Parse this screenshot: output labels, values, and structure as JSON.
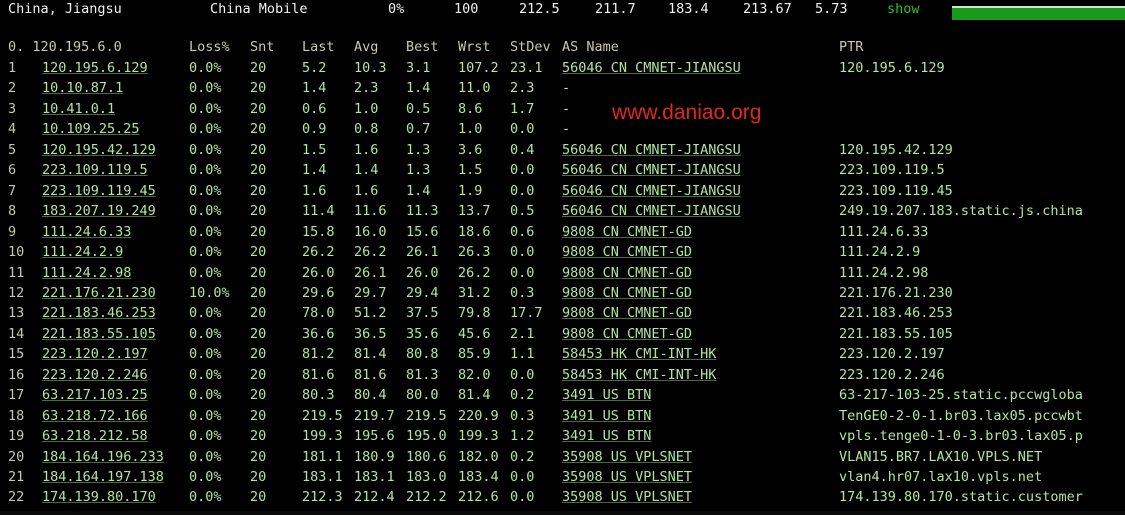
{
  "summary": {
    "location": "China, Jiangsu",
    "provider": "China Mobile",
    "loss": "0%",
    "sent": "100",
    "last": "212.5",
    "best": "211.7",
    "wrst": "183.4",
    "avg": "213.67",
    "stdev": "5.73",
    "show_label": "show"
  },
  "columns": {
    "index_ip": "0.  120.195.6.0",
    "loss": "Loss%",
    "snt": "Snt",
    "last": "Last",
    "avg": "Avg",
    "best": "Best",
    "wrst": "Wrst",
    "stdev": "StDev",
    "as_name": "AS Name",
    "ptr": "PTR"
  },
  "watermark": "www.daniao.org",
  "hops": [
    {
      "n": "1",
      "ip": "120.195.6.129",
      "loss": "0.0%",
      "snt": "20",
      "last": "5.2",
      "avg": "10.3",
      "best": "3.1",
      "wrst": "107.2",
      "stdev": "23.1",
      "as": "56046 CN CMNET-JIANGSU",
      "ptr": "120.195.6.129"
    },
    {
      "n": "2",
      "ip": "10.10.87.1",
      "loss": "0.0%",
      "snt": "20",
      "last": "1.4",
      "avg": "2.3",
      "best": "1.4",
      "wrst": "11.0",
      "stdev": "2.3",
      "as": "-",
      "ptr": ""
    },
    {
      "n": "3",
      "ip": "10.41.0.1",
      "loss": "0.0%",
      "snt": "20",
      "last": "0.6",
      "avg": "1.0",
      "best": "0.5",
      "wrst": "8.6",
      "stdev": "1.7",
      "as": "-",
      "ptr": ""
    },
    {
      "n": "4",
      "ip": "10.109.25.25",
      "loss": "0.0%",
      "snt": "20",
      "last": "0.9",
      "avg": "0.8",
      "best": "0.7",
      "wrst": "1.0",
      "stdev": "0.0",
      "as": "-",
      "ptr": ""
    },
    {
      "n": "5",
      "ip": "120.195.42.129",
      "loss": "0.0%",
      "snt": "20",
      "last": "1.5",
      "avg": "1.6",
      "best": "1.3",
      "wrst": "3.6",
      "stdev": "0.4",
      "as": "56046 CN CMNET-JIANGSU",
      "ptr": "120.195.42.129"
    },
    {
      "n": "6",
      "ip": "223.109.119.5",
      "loss": "0.0%",
      "snt": "20",
      "last": "1.4",
      "avg": "1.4",
      "best": "1.3",
      "wrst": "1.5",
      "stdev": "0.0",
      "as": "56046 CN CMNET-JIANGSU",
      "ptr": "223.109.119.5"
    },
    {
      "n": "7",
      "ip": "223.109.119.45",
      "loss": "0.0%",
      "snt": "20",
      "last": "1.6",
      "avg": "1.6",
      "best": "1.4",
      "wrst": "1.9",
      "stdev": "0.0",
      "as": "56046 CN CMNET-JIANGSU",
      "ptr": "223.109.119.45"
    },
    {
      "n": "8",
      "ip": "183.207.19.249",
      "loss": "0.0%",
      "snt": "20",
      "last": "11.4",
      "avg": "11.6",
      "best": "11.3",
      "wrst": "13.7",
      "stdev": "0.5",
      "as": "56046 CN CMNET-JIANGSU",
      "ptr": "249.19.207.183.static.js.china"
    },
    {
      "n": "9",
      "ip": "111.24.6.33",
      "loss": "0.0%",
      "snt": "20",
      "last": "15.8",
      "avg": "16.0",
      "best": "15.6",
      "wrst": "18.6",
      "stdev": "0.6",
      "as": "9808  CN CMNET-GD",
      "ptr": "111.24.6.33"
    },
    {
      "n": "10",
      "ip": "111.24.2.9",
      "loss": "0.0%",
      "snt": "20",
      "last": "26.2",
      "avg": "26.2",
      "best": "26.1",
      "wrst": "26.3",
      "stdev": "0.0",
      "as": "9808  CN CMNET-GD",
      "ptr": "111.24.2.9"
    },
    {
      "n": "11",
      "ip": "111.24.2.98",
      "loss": "0.0%",
      "snt": "20",
      "last": "26.0",
      "avg": "26.1",
      "best": "26.0",
      "wrst": "26.2",
      "stdev": "0.0",
      "as": "9808  CN CMNET-GD",
      "ptr": "111.24.2.98"
    },
    {
      "n": "12",
      "ip": "221.176.21.230",
      "loss": "10.0%",
      "snt": "20",
      "last": "29.6",
      "avg": "29.7",
      "best": "29.4",
      "wrst": "31.2",
      "stdev": "0.3",
      "as": "9808  CN CMNET-GD",
      "ptr": "221.176.21.230"
    },
    {
      "n": "13",
      "ip": "221.183.46.253",
      "loss": "0.0%",
      "snt": "20",
      "last": "78.0",
      "avg": "51.2",
      "best": "37.5",
      "wrst": "79.8",
      "stdev": "17.7",
      "as": "9808  CN CMNET-GD",
      "ptr": "221.183.46.253"
    },
    {
      "n": "14",
      "ip": "221.183.55.105",
      "loss": "0.0%",
      "snt": "20",
      "last": "36.6",
      "avg": "36.5",
      "best": "35.6",
      "wrst": "45.6",
      "stdev": "2.1",
      "as": "9808  CN CMNET-GD",
      "ptr": "221.183.55.105"
    },
    {
      "n": "15",
      "ip": "223.120.2.197",
      "loss": "0.0%",
      "snt": "20",
      "last": "81.2",
      "avg": "81.4",
      "best": "80.8",
      "wrst": "85.9",
      "stdev": "1.1",
      "as": "58453 HK CMI-INT-HK",
      "ptr": "223.120.2.197"
    },
    {
      "n": "16",
      "ip": "223.120.2.246",
      "loss": "0.0%",
      "snt": "20",
      "last": "81.6",
      "avg": "81.6",
      "best": "81.3",
      "wrst": "82.0",
      "stdev": "0.0",
      "as": "58453 HK CMI-INT-HK",
      "ptr": "223.120.2.246"
    },
    {
      "n": "17",
      "ip": "63.217.103.25",
      "loss": "0.0%",
      "snt": "20",
      "last": "80.3",
      "avg": "80.4",
      "best": "80.0",
      "wrst": "81.4",
      "stdev": "0.2",
      "as": "3491  US BTN",
      "ptr": "63-217-103-25.static.pccwgloba"
    },
    {
      "n": "18",
      "ip": "63.218.72.166",
      "loss": "0.0%",
      "snt": "20",
      "last": "219.5",
      "avg": "219.7",
      "best": "219.5",
      "wrst": "220.9",
      "stdev": "0.3",
      "as": "3491  US BTN",
      "ptr": "TenGE0-2-0-1.br03.lax05.pccwbt"
    },
    {
      "n": "19",
      "ip": "63.218.212.58",
      "loss": "0.0%",
      "snt": "20",
      "last": "199.3",
      "avg": "195.6",
      "best": "195.0",
      "wrst": "199.3",
      "stdev": "1.2",
      "as": "3491  US BTN",
      "ptr": "vpls.tenge0-1-0-3.br03.lax05.p"
    },
    {
      "n": "20",
      "ip": "184.164.196.233",
      "loss": "0.0%",
      "snt": "20",
      "last": "181.1",
      "avg": "180.9",
      "best": "180.6",
      "wrst": "182.0",
      "stdev": "0.2",
      "as": "35908 US VPLSNET",
      "ptr": "VLAN15.BR7.LAX10.VPLS.NET"
    },
    {
      "n": "21",
      "ip": "184.164.197.138",
      "loss": "0.0%",
      "snt": "20",
      "last": "183.1",
      "avg": "183.1",
      "best": "183.0",
      "wrst": "183.4",
      "stdev": "0.0",
      "as": "35908 US VPLSNET",
      "ptr": "vlan4.hr07.lax10.vpls.net"
    },
    {
      "n": "22",
      "ip": "174.139.80.170",
      "loss": "0.0%",
      "snt": "20",
      "last": "212.3",
      "avg": "212.4",
      "best": "212.2",
      "wrst": "212.6",
      "stdev": "0.0",
      "as": "35908 US VPLSNET",
      "ptr": "174.139.80.170.static.customer"
    }
  ]
}
